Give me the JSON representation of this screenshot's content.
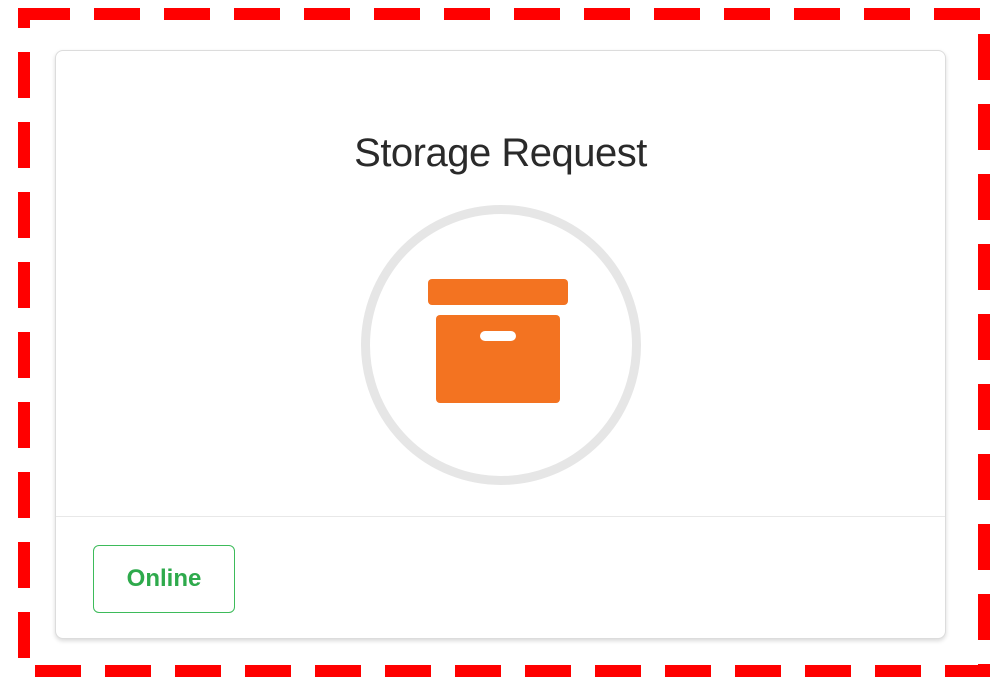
{
  "card": {
    "title": "Storage Request",
    "icon": "archive-box-icon",
    "status_label": "Online"
  },
  "colors": {
    "accent": "#f37321",
    "ring": "#e6e6e6",
    "status_green": "#2eaa4c",
    "selection_frame": "#ff0000"
  }
}
